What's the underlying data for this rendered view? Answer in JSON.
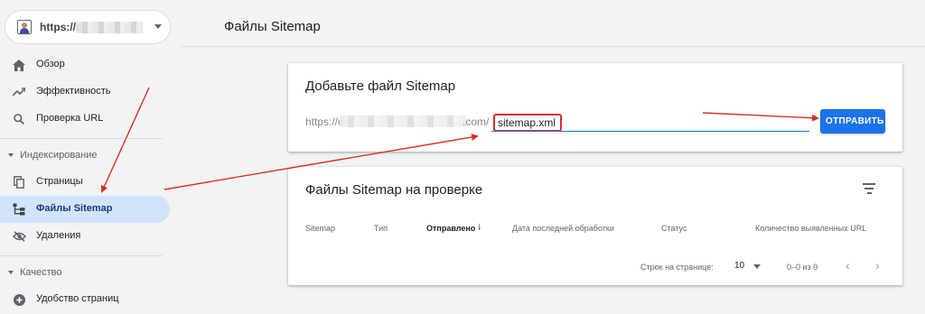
{
  "property": {
    "url_visible": "https://c"
  },
  "sidebar": {
    "items": [
      {
        "label": "Обзор"
      },
      {
        "label": "Эффективность"
      },
      {
        "label": "Проверка URL"
      }
    ],
    "sections": [
      {
        "label": "Индексирование"
      },
      {
        "label": "Качество"
      }
    ],
    "indexing_items": [
      {
        "label": "Страницы"
      },
      {
        "label": "Файлы Sitemap"
      },
      {
        "label": "Удаления"
      }
    ],
    "quality_items": [
      {
        "label": "Удобство страниц"
      }
    ]
  },
  "main": {
    "page_title": "Файлы Sitemap",
    "add_card": {
      "title": "Добавьте файл Sitemap",
      "url_prefix_start": "https://c",
      "url_prefix_end": ".com/",
      "input_value": "sitemap.xml",
      "submit_label": "ОТПРАВИТЬ"
    },
    "list_card": {
      "title": "Файлы Sitemap на проверке",
      "columns": [
        "Sitemap",
        "Тип",
        "Отправлено",
        "Дата последней обработки",
        "Статус",
        "Количество выявленных URL"
      ],
      "rows_per_page_label": "Строк на странице:",
      "rows_per_page_value": "10",
      "range_text": "0–0 из 0"
    }
  },
  "colors": {
    "accent": "#1a73e8",
    "active_nav_bg": "#d2e3fc",
    "annotation": "#d93025"
  },
  "icons": {
    "overview": "home-icon",
    "performance": "trending-up-icon",
    "url_inspection": "search-icon",
    "pages": "pages-icon",
    "sitemaps": "sitemap-icon",
    "removals": "visibility-off-icon",
    "page_experience": "add-circle-icon",
    "filter": "filter-icon"
  }
}
